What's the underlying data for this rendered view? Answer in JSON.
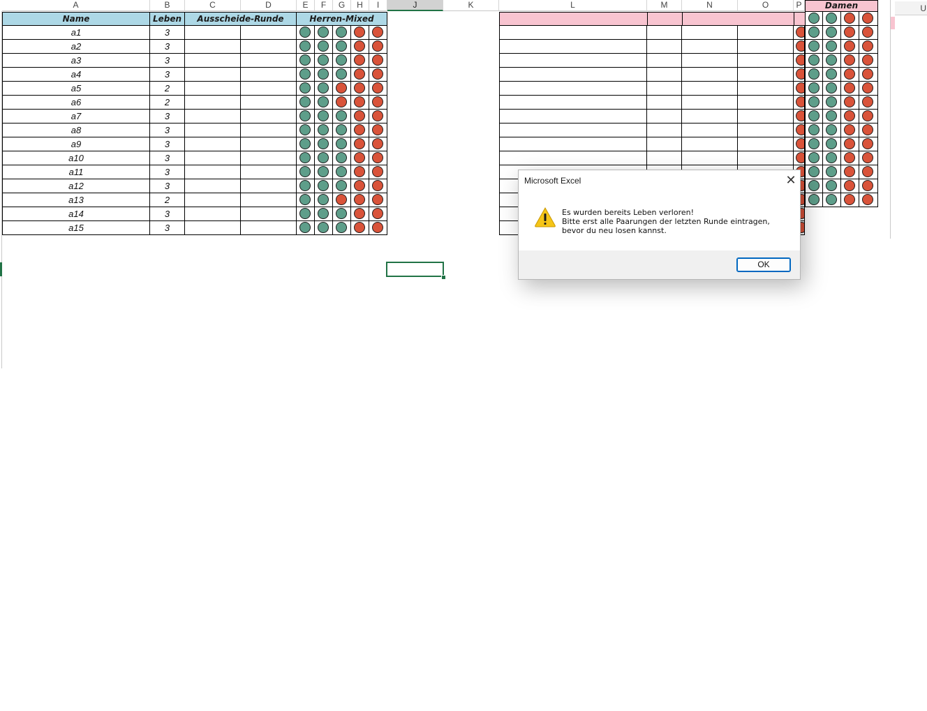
{
  "column_headers": {
    "A": "A",
    "B": "B",
    "C": "C",
    "D": "D",
    "E": "E",
    "F": "F",
    "G": "G",
    "H": "H",
    "I": "I",
    "J": "J",
    "K": "K",
    "L": "L",
    "M": "M",
    "N": "N",
    "O": "O",
    "P": "P",
    "U": "U"
  },
  "left_table": {
    "headers": {
      "name": "Name",
      "lives": "Leben",
      "round": "Ausscheide-Runde",
      "mixed": "Herren-Mixed"
    },
    "rows": [
      {
        "name": "a1",
        "lives": "3",
        "dots": [
          "green",
          "green",
          "green",
          "red",
          "red"
        ]
      },
      {
        "name": "a2",
        "lives": "3",
        "dots": [
          "green",
          "green",
          "green",
          "red",
          "red"
        ]
      },
      {
        "name": "a3",
        "lives": "3",
        "dots": [
          "green",
          "green",
          "green",
          "red",
          "red"
        ]
      },
      {
        "name": "a4",
        "lives": "3",
        "dots": [
          "green",
          "green",
          "green",
          "red",
          "red"
        ]
      },
      {
        "name": "a5",
        "lives": "2",
        "dots": [
          "green",
          "green",
          "red",
          "red",
          "red"
        ]
      },
      {
        "name": "a6",
        "lives": "2",
        "dots": [
          "green",
          "green",
          "red",
          "red",
          "red"
        ]
      },
      {
        "name": "a7",
        "lives": "3",
        "dots": [
          "green",
          "green",
          "green",
          "red",
          "red"
        ]
      },
      {
        "name": "a8",
        "lives": "3",
        "dots": [
          "green",
          "green",
          "green",
          "red",
          "red"
        ]
      },
      {
        "name": "a9",
        "lives": "3",
        "dots": [
          "green",
          "green",
          "green",
          "red",
          "red"
        ]
      },
      {
        "name": "a10",
        "lives": "3",
        "dots": [
          "green",
          "green",
          "green",
          "red",
          "red"
        ]
      },
      {
        "name": "a11",
        "lives": "3",
        "dots": [
          "green",
          "green",
          "green",
          "red",
          "red"
        ]
      },
      {
        "name": "a12",
        "lives": "3",
        "dots": [
          "green",
          "green",
          "green",
          "red",
          "red"
        ]
      },
      {
        "name": "a13",
        "lives": "2",
        "dots": [
          "green",
          "green",
          "red",
          "red",
          "red"
        ]
      },
      {
        "name": "a14",
        "lives": "3",
        "dots": [
          "green",
          "green",
          "green",
          "red",
          "red"
        ]
      },
      {
        "name": "a15",
        "lives": "3",
        "dots": [
          "green",
          "green",
          "green",
          "red",
          "red"
        ]
      }
    ]
  },
  "damen": {
    "header": "Damen",
    "rows": [
      [
        "green",
        "green",
        "red",
        "red"
      ],
      [
        "green",
        "green",
        "red",
        "red"
      ],
      [
        "green",
        "green",
        "red",
        "red"
      ],
      [
        "green",
        "green",
        "red",
        "red"
      ],
      [
        "green",
        "green",
        "red",
        "red"
      ],
      [
        "green",
        "green",
        "red",
        "red"
      ],
      [
        "green",
        "green",
        "red",
        "red"
      ],
      [
        "green",
        "green",
        "red",
        "red"
      ],
      [
        "green",
        "green",
        "red",
        "red"
      ],
      [
        "green",
        "green",
        "red",
        "red"
      ],
      [
        "green",
        "green",
        "red",
        "red"
      ],
      [
        "green",
        "green",
        "red",
        "red"
      ],
      [
        "green",
        "green",
        "red",
        "red"
      ],
      [
        "green",
        "green",
        "red",
        "red"
      ]
    ]
  },
  "dialog": {
    "title": "Microsoft Excel",
    "icon": "warning-icon",
    "message_line1": "Es wurden bereits Leben verloren!",
    "message_line2": "Bitte erst alle Paarungen der letzten Runde eintragen, bevor du neu losen kannst.",
    "ok_label": "OK"
  },
  "colors": {
    "header_blue": "#add8e6",
    "header_pink": "#f8c4d0",
    "dot_green": "#5e9e8a",
    "dot_red": "#d9533a",
    "selection": "#217346"
  }
}
